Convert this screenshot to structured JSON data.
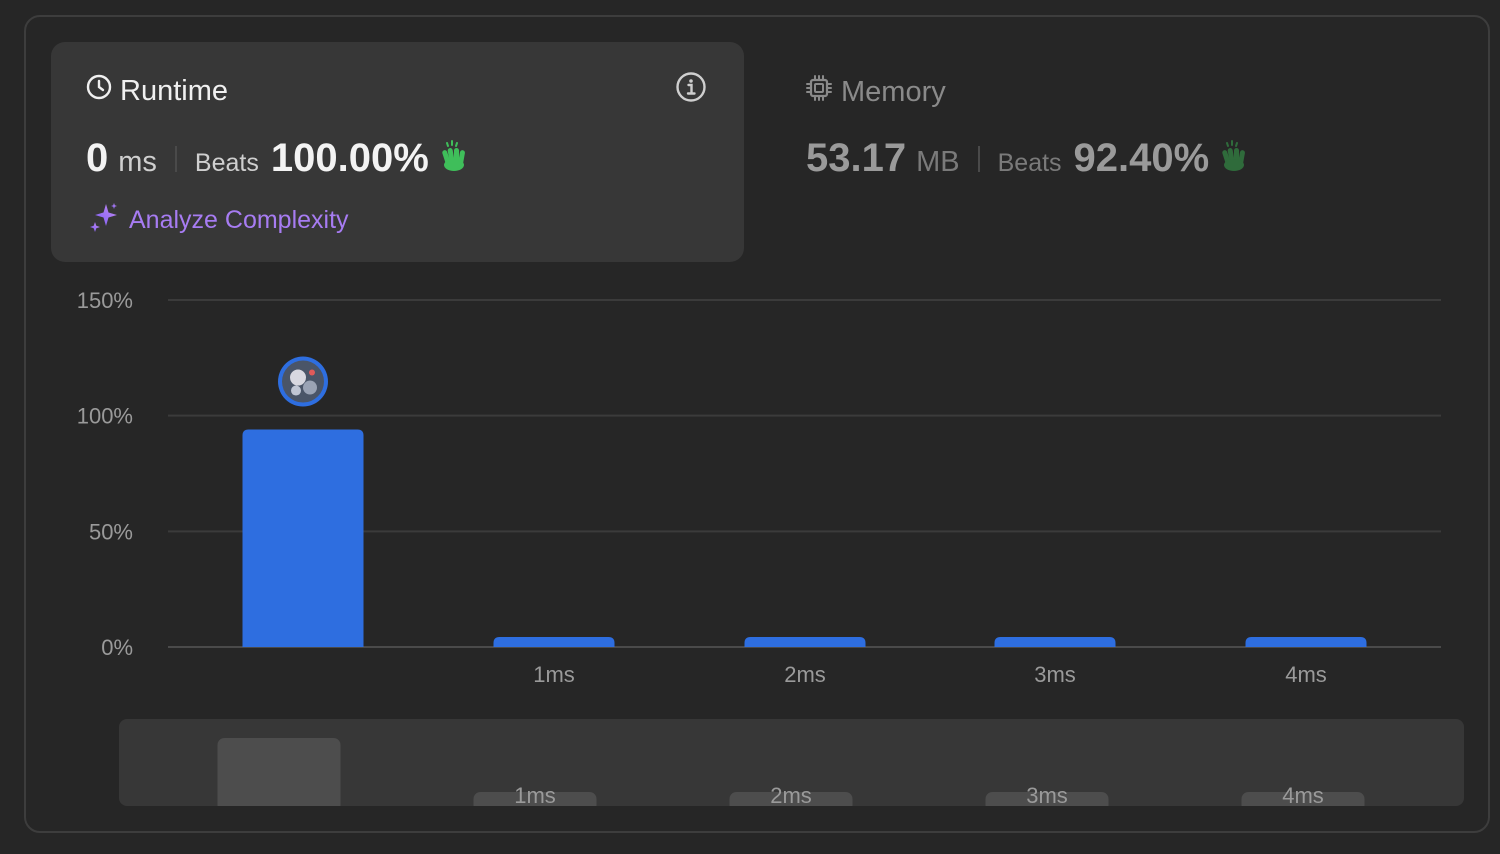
{
  "runtime": {
    "title": "Runtime",
    "value": "0",
    "unit": "ms",
    "beats_label": "Beats",
    "beats_pct": "100.00%",
    "analyze_label": "Analyze Complexity"
  },
  "memory": {
    "title": "Memory",
    "value": "53.17",
    "unit": "MB",
    "beats_label": "Beats",
    "beats_pct": "92.40%"
  },
  "colors": {
    "bar": "#2e6ee0",
    "overview_bar": "#4d4d4d",
    "clap_green": "#3fbe5a",
    "analyze_purple": "#a77cf2"
  },
  "icons": {
    "runtime": "clock-icon",
    "memory": "chip-icon",
    "info": "info-icon",
    "analyze": "sparkle-icon",
    "celebrate": "clap-icon",
    "marker": "avatar"
  },
  "chart_data": {
    "type": "bar",
    "categories": [
      "",
      "1ms",
      "2ms",
      "3ms",
      "4ms"
    ],
    "values": [
      94,
      4,
      4,
      4,
      4
    ],
    "ylim": [
      0,
      150
    ],
    "yticks": [
      0,
      50,
      100,
      150
    ],
    "ytick_labels": [
      "0%",
      "50%",
      "100%",
      "150%"
    ],
    "grid": true,
    "marker_index": 0
  },
  "overview": {
    "categories": [
      "",
      "1ms",
      "2ms",
      "3ms",
      "4ms"
    ],
    "values": [
      94,
      4,
      4,
      4,
      4
    ]
  }
}
